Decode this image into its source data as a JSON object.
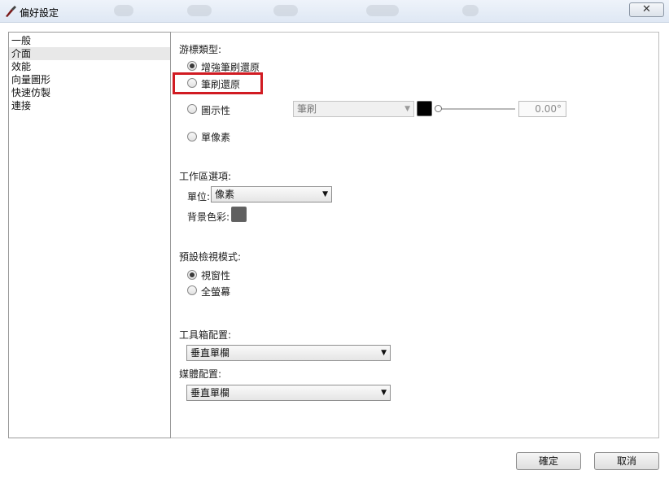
{
  "window": {
    "title": "偏好設定",
    "close_glyph": "✕"
  },
  "sidebar": {
    "items": [
      {
        "label": "一般",
        "selected": false
      },
      {
        "label": "介面",
        "selected": true
      },
      {
        "label": "效能",
        "selected": false
      },
      {
        "label": "向量圖形",
        "selected": false
      },
      {
        "label": "快速仿製",
        "selected": false
      },
      {
        "label": "連接",
        "selected": false
      }
    ]
  },
  "cursor_type": {
    "heading": "游標類型:",
    "options": [
      {
        "label": "增強筆刷還原",
        "checked": true
      },
      {
        "label": "筆刷還原",
        "checked": false
      },
      {
        "label": "圖示性",
        "checked": false
      },
      {
        "label": "單像素",
        "checked": false
      }
    ],
    "brush_select": {
      "value": "筆刷",
      "enabled": false
    },
    "cursor_color": "#000000",
    "angle": "0.00°"
  },
  "workspace": {
    "heading": "工作區選項:",
    "unit_label": "單位:",
    "unit_value": "像素",
    "bg_color_label": "背景色彩:",
    "bg_color": "#606060"
  },
  "view_mode": {
    "heading": "預設檢視模式:",
    "options": [
      {
        "label": "視窗性",
        "checked": true
      },
      {
        "label": "全螢幕",
        "checked": false
      }
    ]
  },
  "toolbar_layout": {
    "heading": "工具箱配置:",
    "value": "垂直單欄"
  },
  "media_layout": {
    "heading": "媒體配置:",
    "value": "垂直單欄"
  },
  "footer": {
    "ok_label": "確定",
    "cancel_label": "取消"
  },
  "colors": {
    "highlight": "#d11b22",
    "titlebar": "#dfe8f4"
  },
  "icons": {
    "app": "brush-icon",
    "close": "close-icon",
    "dropdown": "dropdown-arrow-icon"
  }
}
